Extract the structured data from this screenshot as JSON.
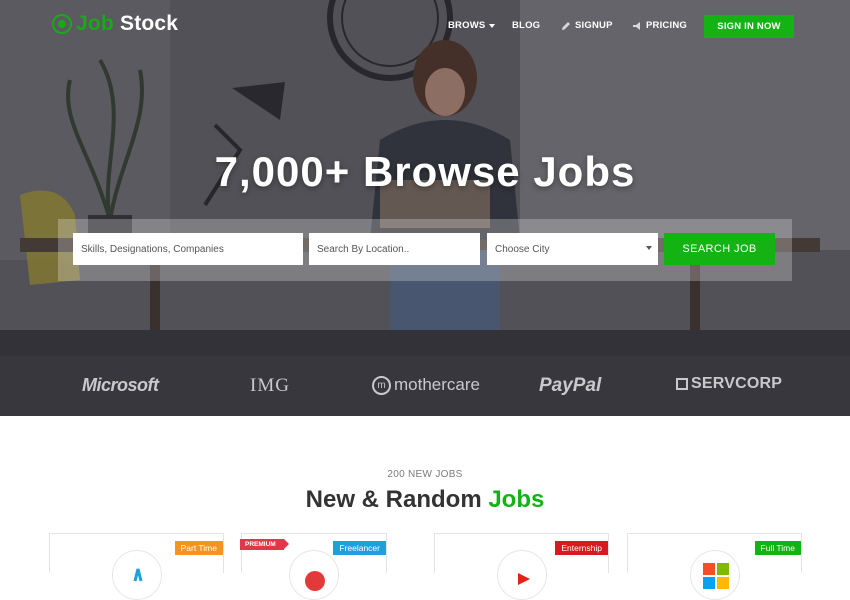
{
  "brand": {
    "name_part1": "Job",
    "name_part2": "Stock"
  },
  "nav": {
    "items": [
      {
        "label": "BROWS",
        "icon": "chevron-down-icon"
      },
      {
        "label": "BLOG"
      },
      {
        "label": "SIGNUP",
        "icon": "pencil-icon"
      },
      {
        "label": "PRICING",
        "icon": "megaphone-icon"
      }
    ],
    "cta": "SIGN IN NOW"
  },
  "hero": {
    "headline": "7,000+ Browse Jobs"
  },
  "search": {
    "keywords_placeholder": "Skills, Designations, Companies",
    "location_placeholder": "Search By Location..",
    "city_selected": "Choose City",
    "button": "SEARCH JOB"
  },
  "partners": [
    "Microsoft",
    "IMG",
    "mothercare",
    "PayPal",
    "SERVCORP"
  ],
  "section": {
    "subtitle": "200 NEW JOBS",
    "title_part1": "New & Random",
    "title_part2": "Jobs"
  },
  "job_cards": [
    {
      "type": "Part Time",
      "type_color": "#f7941d"
    },
    {
      "type": "Freelancer",
      "type_color": "#1ea0dc",
      "badge": "PREMIUM"
    },
    {
      "type": "Enternship",
      "type_color": "#d71920"
    },
    {
      "type": "Full Time",
      "type_color": "#12b312"
    }
  ],
  "colors": {
    "accent": "#12b312",
    "brand_green": "#1aa81a"
  }
}
